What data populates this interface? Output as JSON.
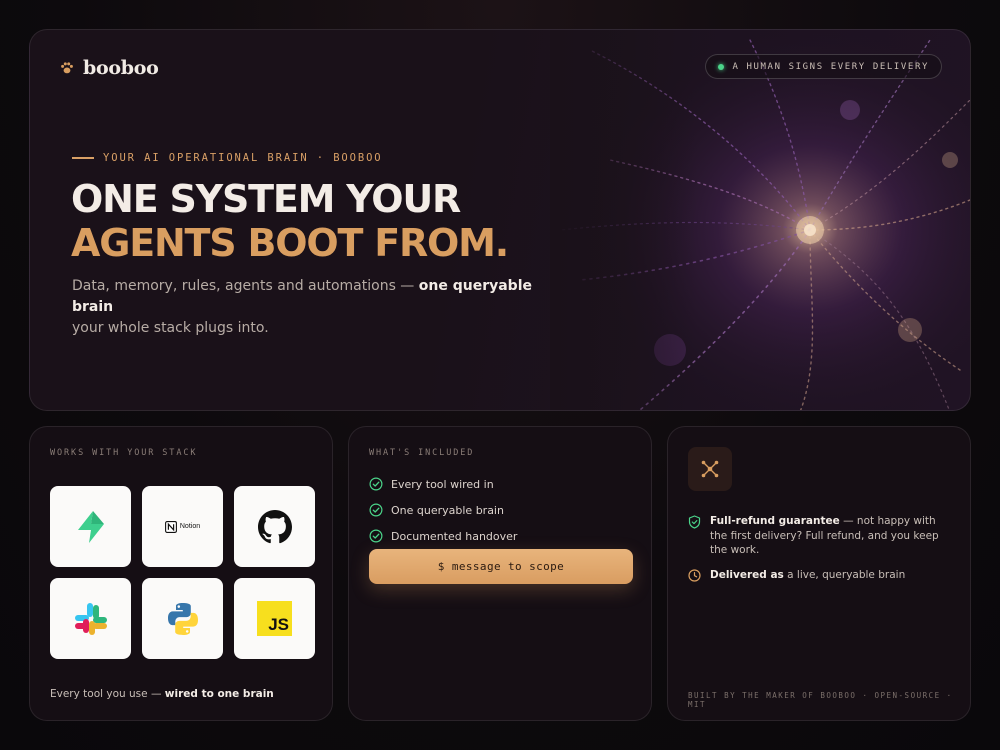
{
  "brand": {
    "name": "booboo",
    "icon": "paw-icon"
  },
  "badge": {
    "text": "A HUMAN SIGNS EVERY DELIVERY",
    "dot_color": "#4bd48a"
  },
  "hero": {
    "eyebrow": "YOUR AI OPERATIONAL BRAIN · BOOBOO",
    "headline_line1": "ONE SYSTEM YOUR",
    "headline_line2": "AGENTS BOOT FROM.",
    "sub_before": "Data, memory, rules, agents and automations — ",
    "sub_bold": "one queryable brain",
    "sub_after": "your whole stack plugs into."
  },
  "stack_card": {
    "label": "WORKS WITH YOUR STACK",
    "tools": [
      {
        "name": "supabase",
        "icon": "supabase-icon"
      },
      {
        "name": "Notion",
        "icon": "notion-icon"
      },
      {
        "name": "github",
        "icon": "github-icon"
      },
      {
        "name": "slack",
        "icon": "slack-icon"
      },
      {
        "name": "python",
        "icon": "python-icon"
      },
      {
        "name": "javascript",
        "icon": "javascript-icon",
        "text": "JS"
      }
    ],
    "footer_before": "Every tool you use — ",
    "footer_bold": "wired to one brain"
  },
  "included_card": {
    "label": "WHAT'S INCLUDED",
    "items": [
      "Every tool wired in",
      "One queryable brain",
      "Documented handover"
    ],
    "cta": "$ message to scope"
  },
  "guarantee_card": {
    "icon": "network-icon",
    "refund_bold": "Full-refund guarantee",
    "refund_text": " — not happy with the first delivery? Full refund, and you keep the work.",
    "delivered_bold": "Delivered as",
    "delivered_text": " a live, queryable brain",
    "footer": "BUILT BY THE MAKER OF BOOBOO · OPEN-SOURCE · MIT"
  },
  "colors": {
    "accent": "#d99e60",
    "check": "#4bd48a",
    "background": "#150e14"
  }
}
